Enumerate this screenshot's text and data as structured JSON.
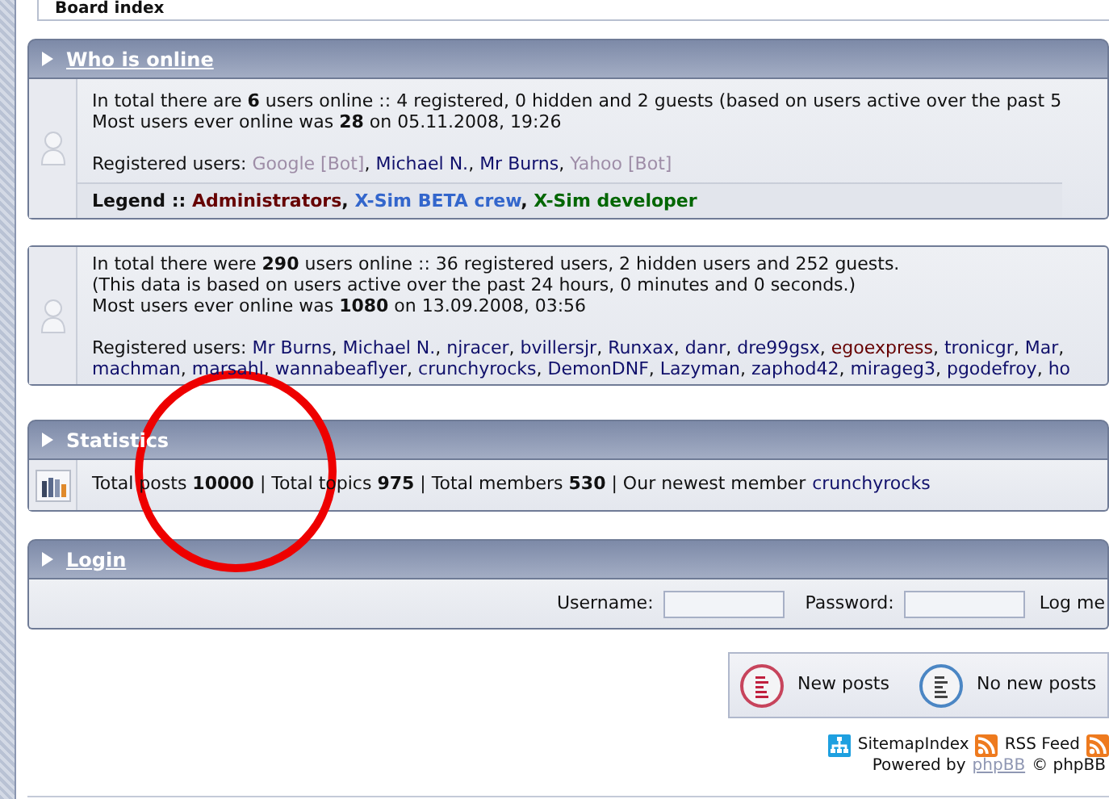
{
  "breadcrumb": "Board index",
  "who_is_online": {
    "title": "Who is online",
    "link": true,
    "lines": [
      "In total there are **6** users online :: 4 registered, 0 hidden and 2 guests (based on users active over the past 5",
      "Most users ever online was **28** on 05.11.2008, 19:26"
    ],
    "registered_label": "Registered users:",
    "separator": ",",
    "user_rows": [
      [
        {
          "name": "Google [Bot]",
          "color": "#9e8da7"
        },
        {
          "name": "Michael N.",
          "color": "#10106b"
        },
        {
          "name": "Mr Burns",
          "color": "#10106b"
        },
        {
          "name": "Yahoo [Bot]",
          "color": "#9e8da7"
        }
      ]
    ],
    "legend": {
      "label": "Legend ::",
      "separator": ",",
      "groups": [
        {
          "name": "Administrators",
          "color": "#660000"
        },
        {
          "name": "X-Sim BETA crew",
          "color": "#3366cc"
        },
        {
          "name": "X-Sim developer",
          "color": "#006600"
        }
      ]
    }
  },
  "past_24_hours": {
    "lines": [
      "In total there were **290** users online :: 36 registered users, 2 hidden users and 252 guests.",
      "(This data is based on users active over the past 24 hours, 0 minutes and 0 seconds.)",
      "Most users ever online was **1080** on 13.09.2008, 03:56"
    ],
    "registered_label": "Registered users:",
    "separator": ",",
    "user_rows": [
      [
        {
          "name": "Mr Burns",
          "color": "#10106b"
        },
        {
          "name": "Michael N.",
          "color": "#10106b"
        },
        {
          "name": "njracer",
          "color": "#10106b"
        },
        {
          "name": "bvillersjr",
          "color": "#10106b"
        },
        {
          "name": "Runxax",
          "color": "#10106b"
        },
        {
          "name": "danr",
          "color": "#10106b"
        },
        {
          "name": "dre99gsx",
          "color": "#10106b"
        },
        {
          "name": "egoexpress",
          "color": "#660000"
        },
        {
          "name": "tronicgr",
          "color": "#10106b"
        },
        {
          "name": "Mar",
          "color": "#10106b"
        }
      ],
      [
        {
          "name": "machman",
          "color": "#10106b"
        },
        {
          "name": "marsahl",
          "color": "#10106b"
        },
        {
          "name": "wannabeaflyer",
          "color": "#10106b"
        },
        {
          "name": "crunchyrocks",
          "color": "#10106b"
        },
        {
          "name": "DemonDNF",
          "color": "#10106b"
        },
        {
          "name": "Lazyman",
          "color": "#10106b"
        },
        {
          "name": "zaphod42",
          "color": "#10106b"
        },
        {
          "name": "mirageg3",
          "color": "#10106b"
        },
        {
          "name": "pgodefroy",
          "color": "#10106b"
        },
        {
          "name": "ho",
          "color": "#10106b"
        }
      ]
    ]
  },
  "statistics": {
    "title": "Statistics",
    "link": false,
    "text": "Total posts **10000** | Total topics **975** | Total members **530** | Our newest member",
    "newest_member": "crunchyrocks"
  },
  "login": {
    "title": "Login",
    "link": true,
    "username_label": "Username:",
    "password_label": "Password:",
    "remember_label": "Log me"
  },
  "icon_legend": [
    {
      "kind": "new",
      "label": "New posts"
    },
    {
      "kind": "none",
      "label": "No new posts"
    }
  ],
  "footer": {
    "links": [
      {
        "kind": "sitemap",
        "label": "SitemapIndex"
      },
      {
        "kind": "rss",
        "label": "RSS Feed"
      },
      {
        "kind": "rss"
      }
    ],
    "powered_by": "Powered by",
    "powered_link": "phpBB",
    "copyright": "© phpBB"
  },
  "annotation": {
    "kind": "circle"
  }
}
